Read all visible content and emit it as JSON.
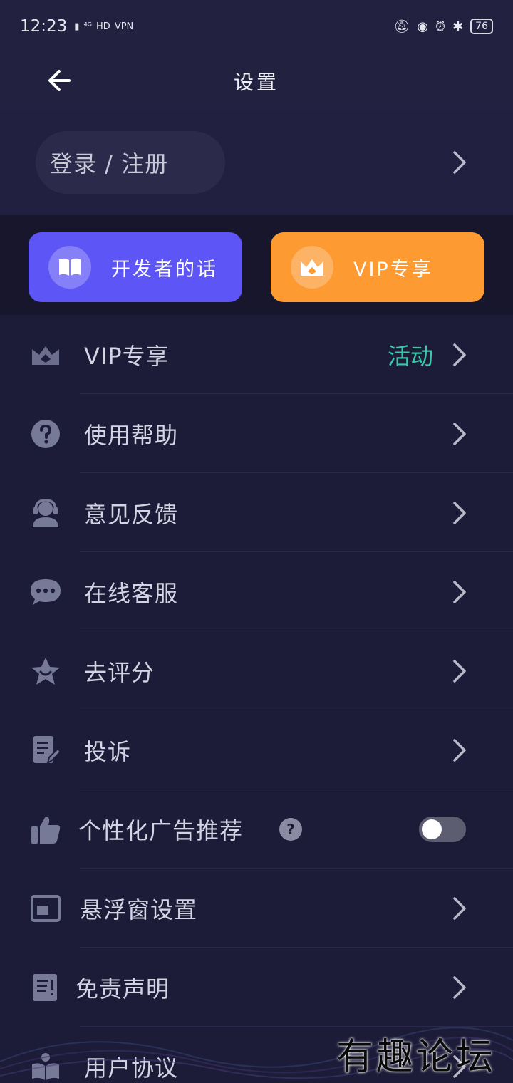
{
  "status_bar": {
    "time": "12:23",
    "network": [
      "⁴ᴳ",
      "HD",
      "VPN"
    ],
    "battery": "76"
  },
  "header": {
    "title": "设置"
  },
  "login": {
    "label": "登录 / 注册"
  },
  "cards": [
    {
      "label": "开发者的话",
      "icon": "book-icon",
      "color": "#5d55f6"
    },
    {
      "label": "VIP专享",
      "icon": "crown-icon",
      "color": "#fd9a32"
    }
  ],
  "menu": {
    "items": [
      {
        "label": "VIP专享",
        "icon": "vip-crown-icon",
        "extra": "活动"
      },
      {
        "label": "使用帮助",
        "icon": "question-icon"
      },
      {
        "label": "意见反馈",
        "icon": "headset-user-icon"
      },
      {
        "label": "在线客服",
        "icon": "chat-bubble-icon"
      },
      {
        "label": "去评分",
        "icon": "star-icon"
      },
      {
        "label": "投诉",
        "icon": "document-edit-icon"
      },
      {
        "label": "个性化广告推荐",
        "icon": "thumbs-up-icon",
        "toggle": false
      },
      {
        "label": "悬浮窗设置",
        "icon": "floating-window-icon"
      },
      {
        "label": "免责声明",
        "icon": "notice-doc-icon"
      },
      {
        "label": "用户协议",
        "icon": "user-agreement-icon"
      }
    ]
  },
  "colors": {
    "background": "#1d1c38",
    "accent_green": "#39c7aa",
    "dev_card": "#5d55f6",
    "vip_card": "#fd9a32"
  },
  "watermark": "有趣论坛"
}
